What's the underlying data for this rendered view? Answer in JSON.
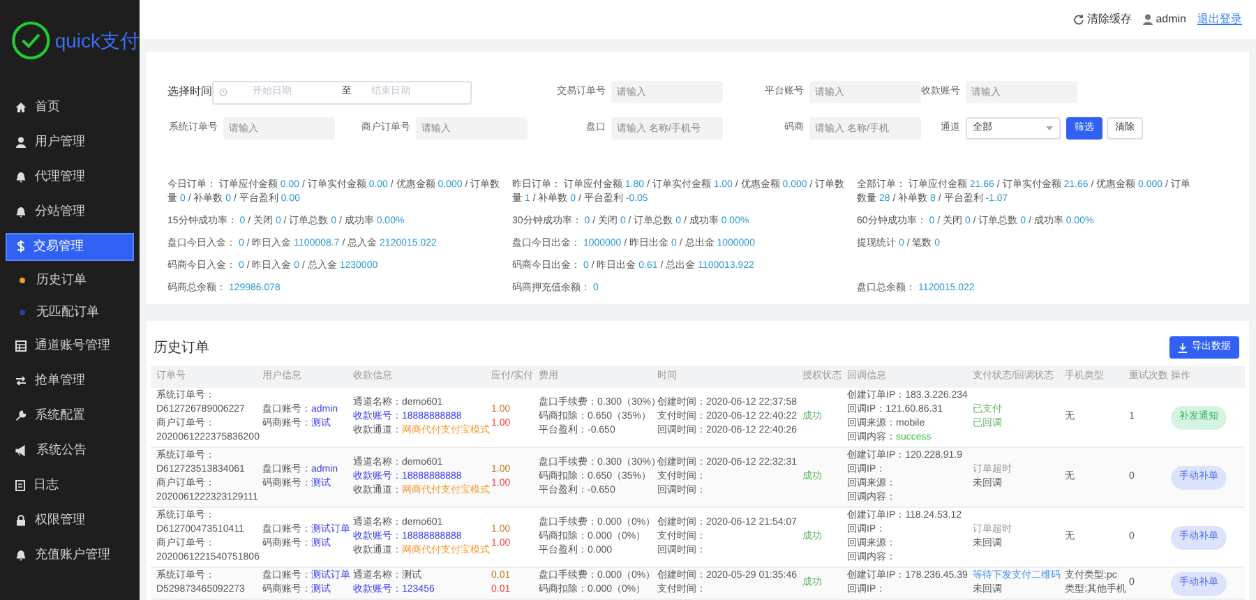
{
  "brand": {
    "name": "quick支付"
  },
  "sidebar": {
    "items": [
      {
        "label": "首页",
        "selected": false
      },
      {
        "label": "用户管理",
        "selected": false
      },
      {
        "label": "代理管理",
        "selected": false
      },
      {
        "label": "分站管理",
        "selected": false
      },
      {
        "label": "交易管理",
        "selected": true,
        "children": [
          {
            "label": "历史订单",
            "color": "#f0a020"
          },
          {
            "label": "无匹配订单",
            "color": "#2a3f9a"
          }
        ]
      },
      {
        "label": "通道账号管理",
        "selected": false
      },
      {
        "label": "抢单管理",
        "selected": false
      },
      {
        "label": "系统配置",
        "selected": false
      },
      {
        "label": "系统公告",
        "selected": false
      },
      {
        "label": "日志",
        "selected": false
      },
      {
        "label": "权限管理",
        "selected": false
      },
      {
        "label": "充值账户管理",
        "selected": false
      }
    ]
  },
  "topbar": {
    "clear_cache": "清除缓存",
    "user": "admin",
    "logout": "退出登录"
  },
  "filters": {
    "rows": [
      [
        {
          "kind": "date_range",
          "label": "选择时间",
          "start_placeholder": "开始日期",
          "separator": "至",
          "end_placeholder": "结束日期"
        },
        "",
        {
          "kind": "input",
          "label": "交易订单号",
          "placeholder": "请输入"
        },
        {
          "kind": "input",
          "label": "平台账号",
          "placeholder": "请输入"
        },
        {
          "kind": "input",
          "label": "收款账号",
          "placeholder": "请输入"
        }
      ],
      [
        {
          "kind": "input",
          "label": "系统订单号",
          "placeholder": "请输入"
        },
        {
          "kind": "input",
          "label": "商户订单号",
          "placeholder": "请输入"
        },
        {
          "kind": "input",
          "label": "盘口",
          "placeholder": "请输入 名称/手机号"
        },
        {
          "kind": "input",
          "label": "码商",
          "placeholder": "请输入 名称/手机"
        },
        {
          "kind": "select",
          "label": "通道",
          "value": "全部"
        }
      ]
    ],
    "buttons": [
      {
        "label": "筛选",
        "kind": "primary"
      },
      {
        "label": "清除",
        "kind": "default"
      }
    ]
  },
  "stats": {
    "rows": [
      [
        {
          "parts": [
            [
              "今日订单： 订单应付金额",
              "0.00"
            ],
            [
              "/ 订单实付金额",
              "0.00"
            ],
            [
              "/ 优惠金额",
              "0.000"
            ],
            [
              "/ 订单数量",
              "0"
            ],
            [
              "/ 补单数",
              "0"
            ],
            [
              "/ 平台盈利",
              "0.00"
            ]
          ]
        },
        {
          "parts": [
            [
              "昨日订单： 订单应付金额",
              "1.80"
            ],
            [
              "/ 订单实付金额",
              "1.00"
            ],
            [
              "/ 优惠金额",
              "0.000"
            ],
            [
              "/ 订单数量",
              "1"
            ],
            [
              "/ 补单数",
              "0"
            ],
            [
              "/ 平台盈利",
              "-0.05"
            ]
          ]
        },
        {
          "parts": [
            [
              "全部订单： 订单应付金额",
              "21.66"
            ],
            [
              "/ 订单实付金额",
              "21.66"
            ],
            [
              "/ 优惠金额",
              "0.000"
            ],
            [
              "/ 订单数量",
              "28"
            ],
            [
              "/ 补单数",
              "8"
            ],
            [
              "/ 平台盈利",
              "-1.07"
            ]
          ]
        }
      ],
      [
        {
          "parts": [
            [
              "15分钟成功率：",
              "0"
            ],
            [
              "/ 关闭",
              "0"
            ],
            [
              "/ 订单总数",
              "0"
            ],
            [
              "/ 成功率",
              "0.00%"
            ]
          ]
        },
        {
          "parts": [
            [
              "30分钟成功率：",
              "0"
            ],
            [
              "/ 关闭",
              "0"
            ],
            [
              "/ 订单总数",
              "0"
            ],
            [
              "/ 成功率",
              "0.00%"
            ]
          ]
        },
        {
          "parts": [
            [
              "60分钟成功率：",
              "0"
            ],
            [
              "/ 关闭",
              "0"
            ],
            [
              "/ 订单总数",
              "0"
            ],
            [
              "/ 成功率",
              "0.00%"
            ]
          ]
        }
      ],
      [
        {
          "parts": [
            [
              "盘口今日入金：",
              "0"
            ],
            [
              "/ 昨日入金",
              "1100008.7"
            ],
            [
              "/ 总入金",
              "2120015.022"
            ]
          ]
        },
        {
          "parts": [
            [
              "盘口今日出金：",
              "1000000"
            ],
            [
              "/ 昨日出金",
              "0"
            ],
            [
              "/ 总出金",
              "1000000"
            ]
          ]
        },
        {
          "parts": [
            [
              "提现统计",
              "0"
            ],
            [
              "/ 笔数",
              "0"
            ]
          ]
        }
      ],
      [
        {
          "parts": [
            [
              "码商今日入金：",
              "0"
            ],
            [
              "/ 昨日入金",
              "0"
            ],
            [
              "/ 总入金",
              "1230000"
            ]
          ]
        },
        {
          "parts": [
            [
              "码商今日出金：",
              "0"
            ],
            [
              "/ 昨日出金",
              "0.61"
            ],
            [
              "/ 总出金",
              "1100013.922"
            ]
          ]
        }
      ],
      [
        {
          "parts": [
            [
              "码商总余额：",
              "129986.078"
            ]
          ]
        },
        {
          "parts": [
            [
              "码商押充值余额：",
              "0"
            ]
          ]
        },
        {
          "parts": [
            [
              "盘口总余额：",
              "1120015.022"
            ]
          ]
        }
      ]
    ]
  },
  "orders": {
    "title": "历史订单",
    "export_button": "导出数据",
    "columns": [
      "订单号",
      "用户信息",
      "收款信息",
      "应付/实付",
      "费用",
      "时间",
      "授权状态",
      "回调信息",
      "支付状态/回调状态",
      "手机类型",
      "重试次数",
      "操作"
    ],
    "rows": [
      {
        "order": [
          "系统订单号：",
          "D612726789006227",
          "商户订单号：",
          "2020061222375836200"
        ],
        "user": [
          [
            "盘口账号：",
            "admin"
          ],
          [
            "码商账号：",
            "测试"
          ]
        ],
        "payee": [
          [
            "通道名称：",
            "demo601"
          ],
          [
            "收款账号：",
            "18888888888"
          ],
          [
            "收款通道：",
            "网商代付支付宝模式"
          ]
        ],
        "amounts": [
          "1.00",
          "1.00"
        ],
        "fees": [
          [
            "盘口手续费：",
            "0.300（30%）"
          ],
          [
            "码商扣除：",
            "0.650（35%）"
          ],
          [
            "平台盈利：",
            "-0.650"
          ]
        ],
        "times": [
          [
            "创建时间：",
            "2020-06-12 22:37:58"
          ],
          [
            "支付时间：",
            "2020-06-12 22:40:22"
          ],
          [
            "回调时间：",
            "2020-06-12 22:40:26"
          ]
        ],
        "auth": "成功",
        "callback": [
          [
            "创建订单IP：",
            "183.3.226.234"
          ],
          [
            "回调IP：",
            "121.60.86.31"
          ],
          [
            "回调来源：",
            "mobile"
          ],
          [
            "回调内容：",
            "success"
          ]
        ],
        "status": [
          {
            "text": "已支付",
            "color": "#5fb35f"
          },
          {
            "text": "已回调",
            "color": "#5fb35f"
          }
        ],
        "phone": [
          "无"
        ],
        "retries": "1",
        "action": {
          "label": "补发通知",
          "kind": "notify"
        }
      },
      {
        "order": [
          "系统订单号：",
          "D612723513834061",
          "商户订单号：",
          "2020061222323129111"
        ],
        "user": [
          [
            "盘口账号：",
            "admin"
          ],
          [
            "码商账号：",
            "测试"
          ]
        ],
        "payee": [
          [
            "通道名称：",
            "demo601"
          ],
          [
            "收款账号：",
            "18888888888"
          ],
          [
            "收款通道：",
            "网商代付支付宝模式"
          ]
        ],
        "amounts": [
          "1.00",
          "1.00"
        ],
        "fees": [
          [
            "盘口手续费：",
            "0.300（30%）"
          ],
          [
            "码商扣除：",
            "0.650（35%）"
          ],
          [
            "平台盈利：",
            "-0.650"
          ]
        ],
        "times": [
          [
            "创建时间：",
            "2020-06-12 22:32:31"
          ],
          [
            "支付时间："
          ],
          [
            "回调时间："
          ]
        ],
        "auth": "成功",
        "callback": [
          [
            "创建订单IP：",
            "120.228.91.9"
          ],
          [
            "回调IP："
          ],
          [
            "回调来源："
          ],
          [
            "回调内容："
          ]
        ],
        "status": [
          {
            "text": "订单超时",
            "color": "#999999"
          },
          {
            "text": "未回调",
            "color": "#555555"
          }
        ],
        "phone": [
          "无"
        ],
        "retries": "0",
        "action": {
          "label": "手动补单",
          "kind": "manual"
        }
      },
      {
        "order": [
          "系统订单号：",
          "D612700473510411",
          "商户订单号：",
          "2020061221540751806"
        ],
        "user": [
          [
            "盘口账号：",
            "测试订单"
          ],
          [
            "码商账号：",
            "测试"
          ]
        ],
        "payee": [
          [
            "通道名称：",
            "demo601"
          ],
          [
            "收款账号：",
            "18888888888"
          ],
          [
            "收款通道：",
            "网商代付支付宝模式"
          ]
        ],
        "amounts": [
          "1.00",
          "1.00"
        ],
        "fees": [
          [
            "盘口手续费：",
            "0.000（0%）"
          ],
          [
            "码商扣除：",
            "0.000（0%）"
          ],
          [
            "平台盈利：",
            "0.000"
          ]
        ],
        "times": [
          [
            "创建时间：",
            "2020-06-12 21:54:07"
          ],
          [
            "支付时间："
          ],
          [
            "回调时间："
          ]
        ],
        "auth": "成功",
        "callback": [
          [
            "创建订单IP：",
            "118.24.53.12"
          ],
          [
            "回调IP："
          ],
          [
            "回调来源："
          ],
          [
            "回调内容："
          ]
        ],
        "status": [
          {
            "text": "订单超时",
            "color": "#999999"
          },
          {
            "text": "未回调",
            "color": "#555555"
          }
        ],
        "phone": [
          "无"
        ],
        "retries": "0",
        "action": {
          "label": "手动补单",
          "kind": "manual"
        }
      },
      {
        "order": [
          "系统订单号：",
          "D529873465092273"
        ],
        "user": [
          [
            "盘口账号：",
            "测试订单"
          ],
          [
            "码商账号：",
            "测试"
          ]
        ],
        "payee": [
          [
            "通道名称：",
            "测试"
          ],
          [
            "收款账号：",
            "123456"
          ]
        ],
        "amounts": [
          "0.01",
          "0.01"
        ],
        "fees": [
          [
            "盘口手续费：",
            "0.000（0%）"
          ],
          [
            "码商扣除：",
            "0.000（0%）"
          ]
        ],
        "times": [
          [
            "创建时间：",
            "2020-05-29 01:35:46"
          ],
          [
            "支付时间："
          ]
        ],
        "auth": "成功",
        "callback": [
          [
            "创建订单IP：",
            "178.236.45.39"
          ],
          [
            "回调IP："
          ]
        ],
        "status": [
          {
            "text": "等待下发支付二维码",
            "color": "#3a8ee6"
          },
          {
            "text": "未回调",
            "color": "#555555"
          }
        ],
        "phone": [
          "支付类型:pc",
          "类型:其他手机"
        ],
        "retries": "0",
        "action": {
          "label": "手动补单",
          "kind": "manual"
        }
      }
    ]
  }
}
